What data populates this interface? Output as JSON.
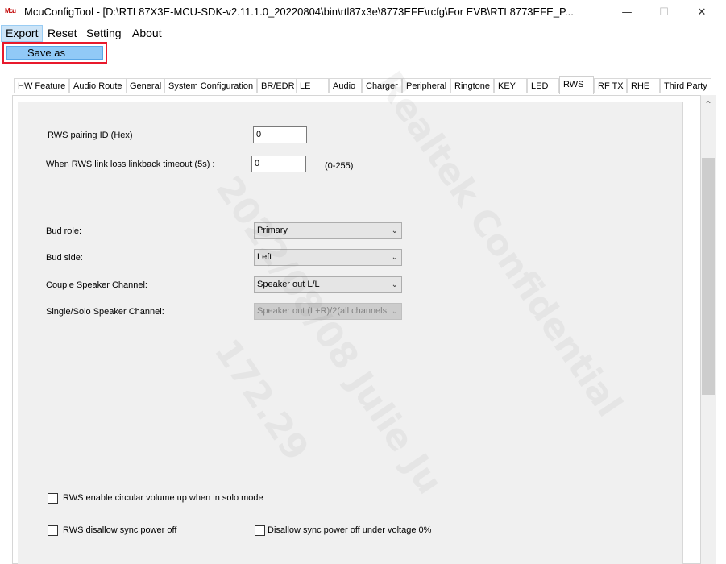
{
  "window": {
    "icon_text": "Mcu",
    "title": "McuConfigTool - [D:\\RTL87X3E-MCU-SDK-v2.11.1.0_20220804\\bin\\rtl87x3e\\8773EFE\\rcfg\\For EVB\\RTL8773EFE_P...",
    "minimize_glyph": "—",
    "maximize_glyph": "☐",
    "close_glyph": "✕"
  },
  "menu": {
    "items": [
      {
        "label": "Export"
      },
      {
        "label": "Reset"
      },
      {
        "label": "Setting"
      },
      {
        "label": "About"
      }
    ],
    "dropdown": {
      "items": [
        {
          "label": "Save as"
        }
      ]
    }
  },
  "tabs": [
    {
      "label": "HW Feature"
    },
    {
      "label": "Audio Route"
    },
    {
      "label": "General"
    },
    {
      "label": "System Configuration"
    },
    {
      "label": "BR/EDR"
    },
    {
      "label": "LE"
    },
    {
      "label": "Audio"
    },
    {
      "label": "Charger"
    },
    {
      "label": "Peripheral"
    },
    {
      "label": "Ringtone"
    },
    {
      "label": "KEY"
    },
    {
      "label": "LED"
    },
    {
      "label": "RWS"
    },
    {
      "label": "RF TX"
    },
    {
      "label": "RHE"
    },
    {
      "label": "Third Party"
    }
  ],
  "active_tab": "RWS",
  "rws": {
    "pairing_id": {
      "label": "RWS pairing ID (Hex)",
      "value": "0"
    },
    "linkback_timeout": {
      "label": "When RWS link loss linkback timeout (5s) :",
      "value": "0",
      "range": "(0-255)"
    },
    "bud_role": {
      "label": "Bud role:",
      "value": "Primary"
    },
    "bud_side": {
      "label": "Bud side:",
      "value": "Left"
    },
    "couple_channel": {
      "label": "Couple Speaker Channel:",
      "value": "Speaker out L/L"
    },
    "solo_channel": {
      "label": "Single/Solo Speaker Channel:",
      "value": "Speaker out (L+R)/2(all channels"
    },
    "circular_volume": {
      "label": "RWS enable circular volume up when in solo mode",
      "checked": false
    },
    "disallow_sync_power_off": {
      "label": "RWS disallow sync power off",
      "checked": false
    },
    "disallow_sync_under_voltage": {
      "label": "Disallow sync power off under voltage 0%",
      "checked": false
    }
  },
  "icons": {
    "chevron": "chevron-down-icon",
    "scroll_up": "scroll-up-arrow-icon"
  },
  "watermark": {
    "line1": "Realtek Confidential",
    "line2": "2022/08/08 Julie Ju",
    "line3": "172.29"
  },
  "colors": {
    "menu_active": "#cce4f7",
    "dropdown_highlight": "#91c9f7",
    "dropdown_border": "#e8192c",
    "panel_bg": "#f0f0f0"
  }
}
